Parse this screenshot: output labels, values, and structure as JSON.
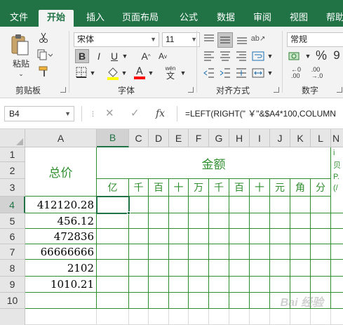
{
  "tabs": [
    "文件",
    "开始",
    "插入",
    "页面布局",
    "公式",
    "数据",
    "审阅",
    "视图",
    "帮助"
  ],
  "active_tab": "开始",
  "ribbon": {
    "clipboard": {
      "paste_label": "粘贴",
      "group_label": "剪贴板"
    },
    "font": {
      "name": "宋体",
      "size": "11",
      "group_label": "字体",
      "bold": "B",
      "italic": "I",
      "underline": "U",
      "grow": "A",
      "shrink": "A",
      "wen_top": "wén",
      "wen_bottom": "文",
      "font_color": "#ff0000",
      "fill_color": "#ffff00"
    },
    "alignment": {
      "group_label": "对齐方式"
    },
    "number": {
      "format": "常规",
      "group_label": "数字",
      "percent": "%",
      "comma": "9"
    }
  },
  "formula_bar": {
    "name_box": "B4",
    "cancel": "✕",
    "enter": "✓",
    "fx": "fx",
    "formula": "=LEFT(RIGHT(\" ￥\"&$A4*100,COLUMN"
  },
  "sheet": {
    "columns": [
      "A",
      "B",
      "C",
      "D",
      "E",
      "F",
      "G",
      "H",
      "I",
      "J",
      "K",
      "L",
      "N"
    ],
    "selected_column": "B",
    "rows": [
      "1",
      "2",
      "3",
      "4",
      "5",
      "6",
      "7",
      "8",
      "9",
      "10"
    ],
    "selected_row": "4",
    "header_total": "总价",
    "header_amount": "金额",
    "digit_units": [
      "亿",
      "千",
      "百",
      "十",
      "万",
      "千",
      "百",
      "十",
      "元",
      "角",
      "分"
    ],
    "values": [
      "412120.28",
      "456.12",
      "472836",
      "66666666",
      "2102",
      "1010.21"
    ],
    "partial_col_text": [
      "i",
      "贝",
      "P.",
      "(/"
    ]
  },
  "watermark": "Bai 经验"
}
